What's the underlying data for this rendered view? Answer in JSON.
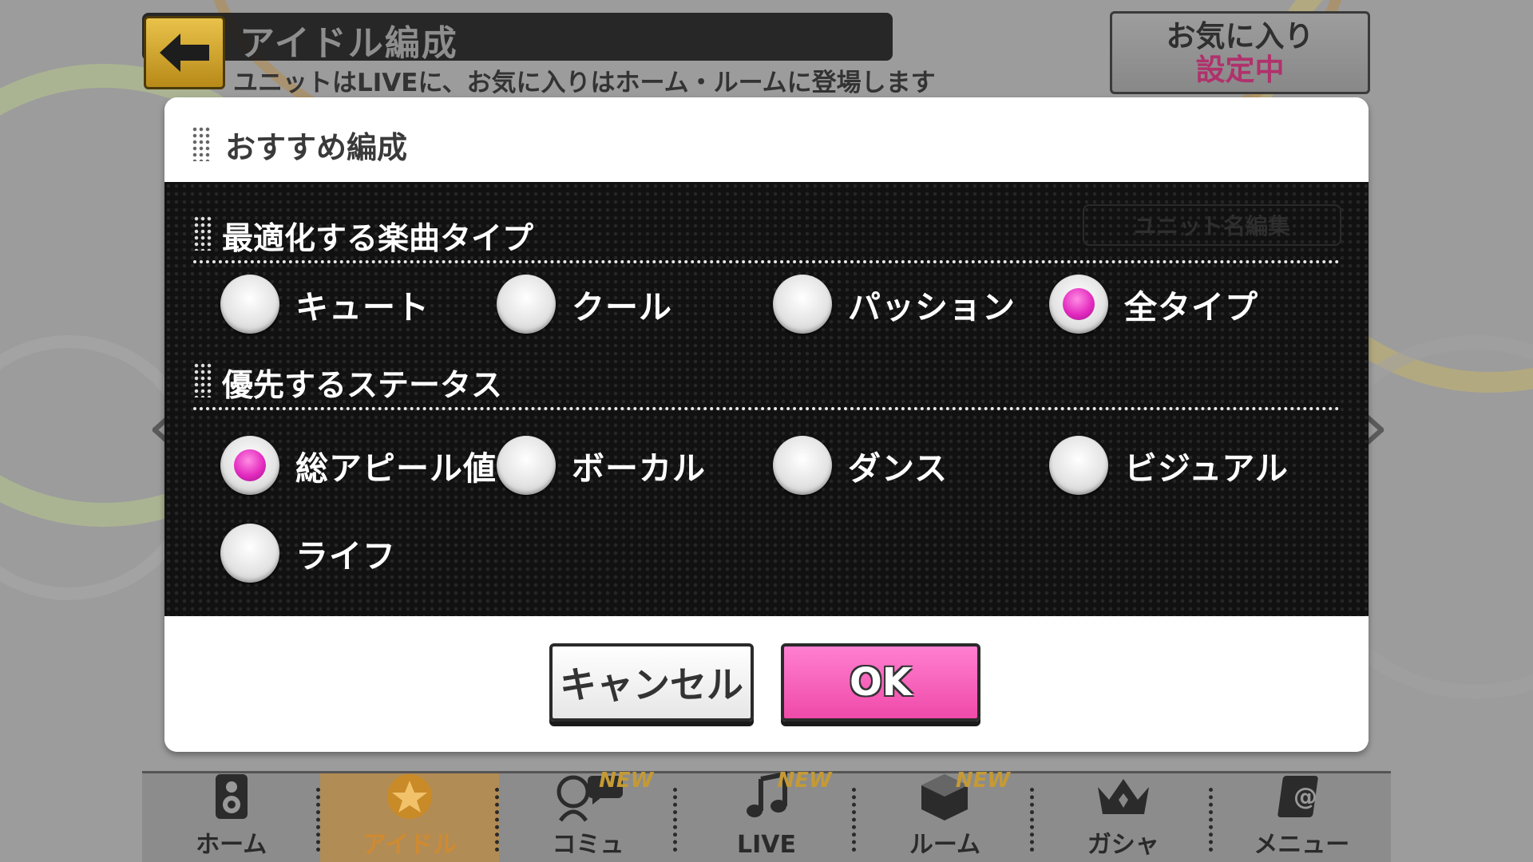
{
  "header": {
    "title": "アイドル編成",
    "subtitle": "ユニットはLIVEに、お気に入りはホーム・ルームに登場します",
    "favorite": {
      "line1": "お気に入り",
      "line2": "設定中"
    }
  },
  "dialog": {
    "title": "おすすめ編成",
    "rename_hint": "ユニット名編集",
    "song_type": {
      "title": "最適化する楽曲タイプ",
      "options": [
        "キュート",
        "クール",
        "パッション",
        "全タイプ"
      ],
      "selected": "全タイプ"
    },
    "status": {
      "title": "優先するステータス",
      "options": [
        "総アピール値",
        "ボーカル",
        "ダンス",
        "ビジュアル",
        "ライフ"
      ],
      "selected": "総アピール値"
    },
    "cancel_label": "キャンセル",
    "ok_label": "OK"
  },
  "bottom_nav": [
    {
      "label": "ホーム",
      "icon": "speaker-icon",
      "new": ""
    },
    {
      "label": "アイドル",
      "icon": "star-icon",
      "new": ""
    },
    {
      "label": "コミュ",
      "icon": "chat-icon",
      "new": "NEW"
    },
    {
      "label": "LIVE",
      "icon": "music-note-icon",
      "new": "NEW"
    },
    {
      "label": "ルーム",
      "icon": "cube-icon",
      "new": "NEW"
    },
    {
      "label": "ガシャ",
      "icon": "crown-icon",
      "new": ""
    },
    {
      "label": "メニュー",
      "icon": "menu-icon",
      "new": ""
    }
  ],
  "colors": {
    "accent_pink": "#e42cc0",
    "ok_button": "#ef4aa9",
    "favorite_text": "#b0316c"
  }
}
